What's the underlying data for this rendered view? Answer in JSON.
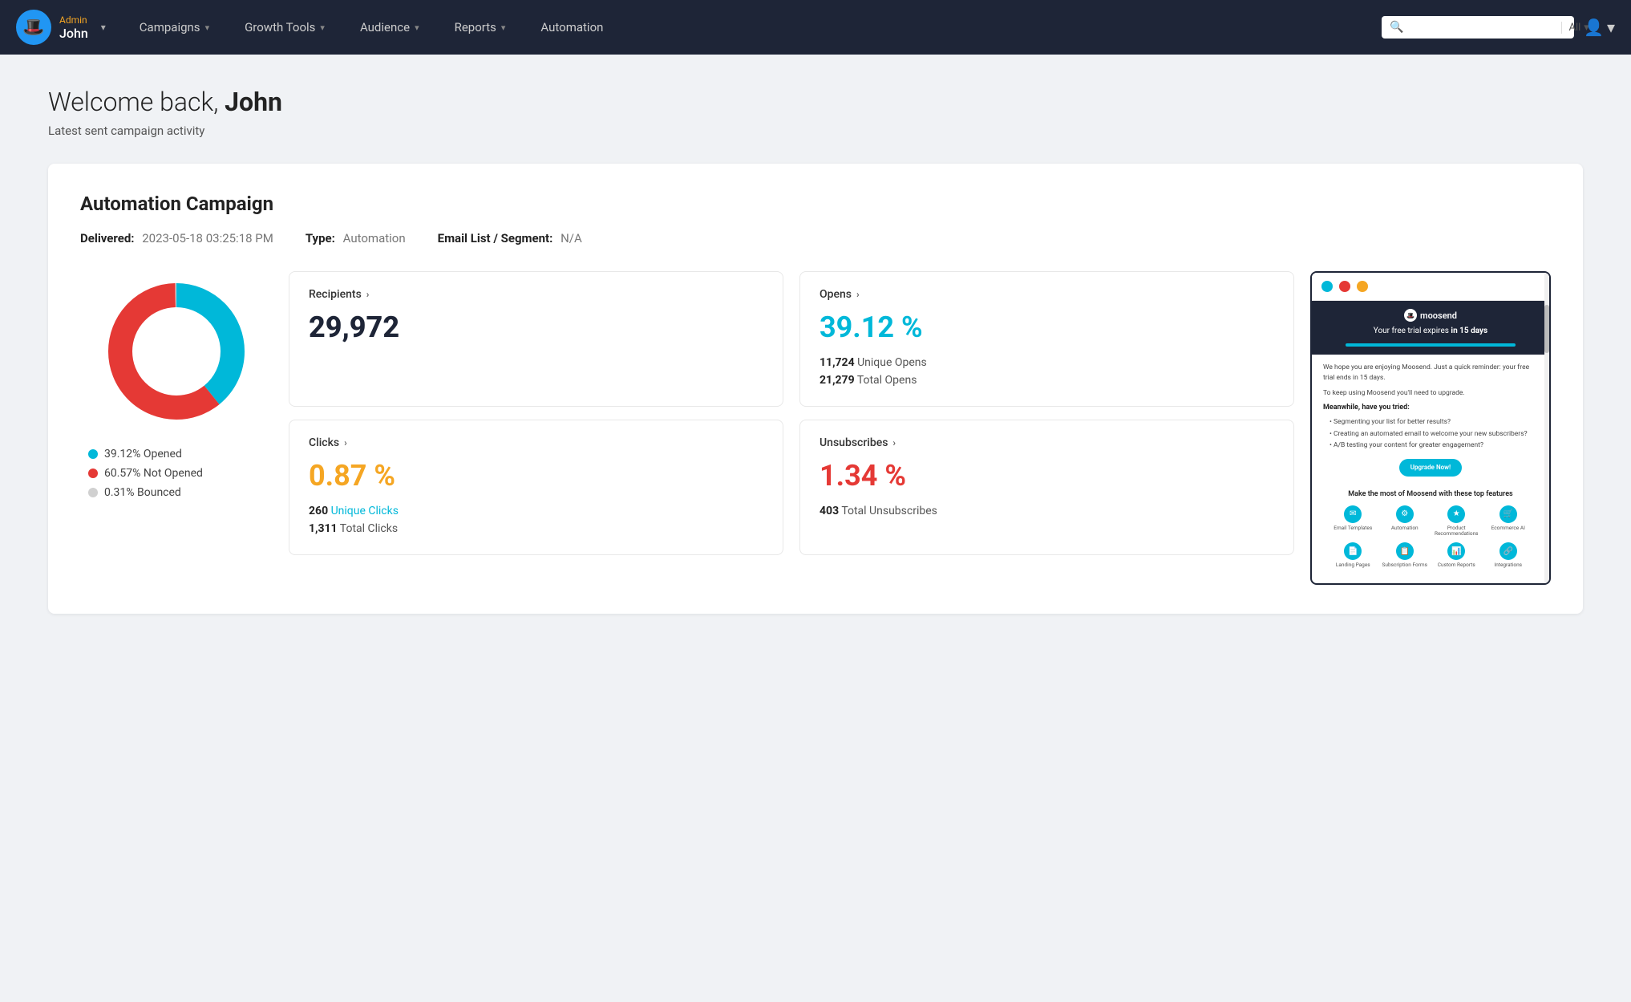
{
  "navbar": {
    "brand": {
      "role": "Admin",
      "name": "John"
    },
    "nav_items": [
      {
        "label": "Campaigns",
        "has_dropdown": true
      },
      {
        "label": "Growth Tools",
        "has_dropdown": true
      },
      {
        "label": "Audience",
        "has_dropdown": true
      },
      {
        "label": "Reports",
        "has_dropdown": true
      },
      {
        "label": "Automation",
        "has_dropdown": false
      }
    ],
    "search": {
      "placeholder": "",
      "filter_label": "All"
    }
  },
  "page": {
    "welcome_prefix": "Welcome back, ",
    "welcome_name": "John",
    "subtitle": "Latest sent campaign activity"
  },
  "campaign": {
    "title": "Automation Campaign",
    "delivered_label": "Delivered:",
    "delivered_value": "2023-05-18 03:25:18 PM",
    "type_label": "Type:",
    "type_value": "Automation",
    "email_list_label": "Email List / Segment:",
    "email_list_value": "N/A",
    "donut": {
      "opened_pct": 39.12,
      "not_opened_pct": 60.57,
      "bounced_pct": 0.31,
      "opened_color": "#00b8d9",
      "not_opened_color": "#e53935",
      "bounced_color": "#d0d0d0",
      "legend": [
        {
          "label": "39.12% Opened",
          "color": "#00b8d9"
        },
        {
          "label": "60.57% Not Opened",
          "color": "#e53935"
        },
        {
          "label": "0.31% Bounced",
          "color": "#d0d0d0"
        }
      ]
    },
    "stats": {
      "recipients": {
        "label": "Recipients",
        "value": "29,972"
      },
      "opens": {
        "label": "Opens",
        "pct": "39.12 %",
        "unique": "11,724",
        "unique_label": "Unique Opens",
        "total": "21,279",
        "total_label": "Total Opens"
      },
      "clicks": {
        "label": "Clicks",
        "pct": "0.87 %",
        "unique": "260",
        "unique_label": "Unique Clicks",
        "total": "1,311",
        "total_label": "Total Clicks"
      },
      "unsubscribes": {
        "label": "Unsubscribes",
        "pct": "1.34 %",
        "total": "403",
        "total_label": "Total Unsubscribes"
      }
    },
    "preview": {
      "dots": [
        "teal",
        "red",
        "yellow"
      ],
      "header_text": "Your free trial expires ",
      "header_bold": "in 15 days",
      "body_p1": "We hope you are enjoying Moosend. Just a quick reminder: your free trial ends in 15 days.",
      "body_p2": "To keep using Moosend you'll need to upgrade.",
      "section_title": "Meanwhile, have you tried:",
      "bullets": [
        "• Segmenting your list for better results?",
        "• Creating an automated email to welcome your new subscribers?",
        "• A/B testing your content for greater engagement?"
      ],
      "cta_label": "Upgrade Now!",
      "features_title": "Make the most of Moosend with these top features",
      "features": [
        {
          "label": "Email Templates",
          "icon": "✉"
        },
        {
          "label": "Automation",
          "icon": "⚙"
        },
        {
          "label": "Product Recommendations",
          "icon": "★"
        },
        {
          "label": "Ecommerce AI",
          "icon": "🛒"
        },
        {
          "label": "Landing Pages",
          "icon": "📄"
        },
        {
          "label": "Subscription Forms",
          "icon": "📋"
        },
        {
          "label": "Custom Reports",
          "icon": "📊"
        },
        {
          "label": "Integrations",
          "icon": "🔗"
        }
      ]
    }
  }
}
